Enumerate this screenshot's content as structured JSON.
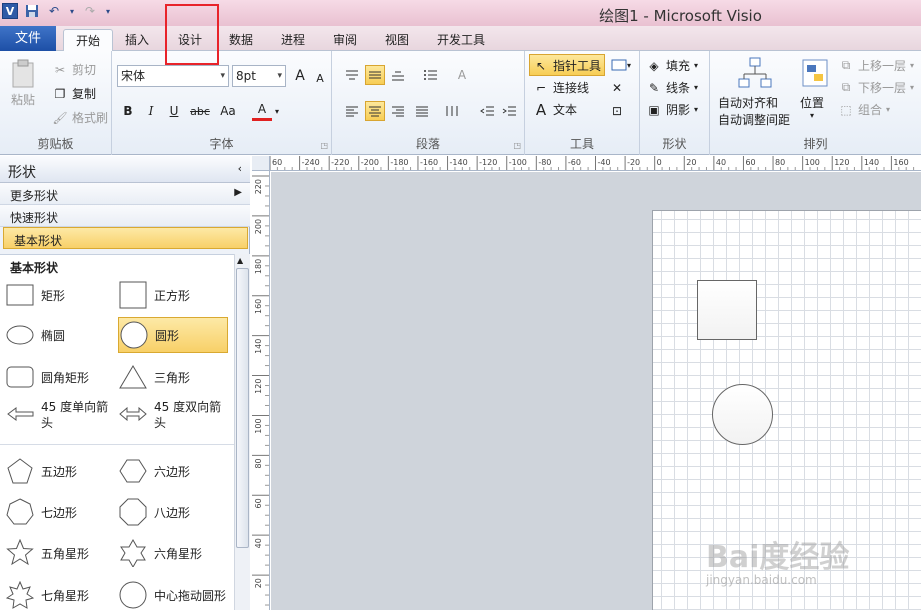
{
  "window": {
    "title": "绘图1 - Microsoft Visio",
    "logo_letter": "V"
  },
  "tabs": [
    {
      "label": "文件"
    },
    {
      "label": "开始"
    },
    {
      "label": "插入"
    },
    {
      "label": "设计"
    },
    {
      "label": "数据"
    },
    {
      "label": "进程"
    },
    {
      "label": "审阅"
    },
    {
      "label": "视图"
    },
    {
      "label": "开发工具"
    }
  ],
  "ribbon": {
    "clipboard": {
      "label": "剪贴板",
      "paste": "粘贴",
      "cut": "剪切",
      "copy": "复制",
      "format_painter": "格式刷"
    },
    "font": {
      "label": "字体",
      "family": "宋体",
      "size": "8pt",
      "bold": "B",
      "italic": "I",
      "underline": "U",
      "strike": "abc",
      "case": "Aa",
      "color": "A",
      "grow": "A",
      "shrink": "A"
    },
    "paragraph": {
      "label": "段落"
    },
    "tools": {
      "label": "工具",
      "pointer": "指针工具",
      "connector": "连接线",
      "text": "文本"
    },
    "shape": {
      "label": "形状",
      "fill": "填充",
      "line": "线条",
      "shadow": "阴影"
    },
    "arrange": {
      "label": "排列",
      "auto_align": "自动对齐和",
      "auto_space": "自动调整间距",
      "position": "位置",
      "bring_forward": "上移一层",
      "send_backward": "下移一层",
      "group": "组合"
    }
  },
  "shapes_panel": {
    "header": "形状",
    "more_shapes": "更多形状",
    "quick_shapes": "快速形状",
    "basic_shapes": "基本形状",
    "stencil_title": "基本形状",
    "items": [
      {
        "label": "矩形",
        "icon": "rectangle"
      },
      {
        "label": "正方形",
        "icon": "square"
      },
      {
        "label": "椭圆",
        "icon": "ellipse"
      },
      {
        "label": "圆形",
        "icon": "circle"
      },
      {
        "label": "圆角矩形",
        "icon": "rounded-rectangle"
      },
      {
        "label": "三角形",
        "icon": "triangle"
      },
      {
        "label": "45 度单向箭头",
        "icon": "single-arrow"
      },
      {
        "label": "45 度双向箭头",
        "icon": "double-arrow"
      },
      {
        "label": "五边形",
        "icon": "pentagon"
      },
      {
        "label": "六边形",
        "icon": "hexagon"
      },
      {
        "label": "七边形",
        "icon": "heptagon"
      },
      {
        "label": "八边形",
        "icon": "octagon"
      },
      {
        "label": "五角星形",
        "icon": "star5"
      },
      {
        "label": "六角星形",
        "icon": "star6"
      },
      {
        "label": "七角星形",
        "icon": "star7"
      },
      {
        "label": "中心拖动圆形",
        "icon": "center-circle"
      }
    ]
  },
  "ruler": {
    "top": [
      "60",
      "-240",
      "-220",
      "-200",
      "-180",
      "-160",
      "-140",
      "-120",
      "-100",
      "-80",
      "-60",
      "-40",
      "-20",
      "0",
      "20",
      "40",
      "60",
      "80",
      "100",
      "120",
      "140",
      "160"
    ],
    "left": [
      "220",
      "200",
      "180",
      "160",
      "140",
      "120",
      "100",
      "80",
      "60",
      "40",
      "20"
    ]
  },
  "watermark": {
    "brand": "Bai度经验",
    "url": "jingyan.baidu.com"
  }
}
